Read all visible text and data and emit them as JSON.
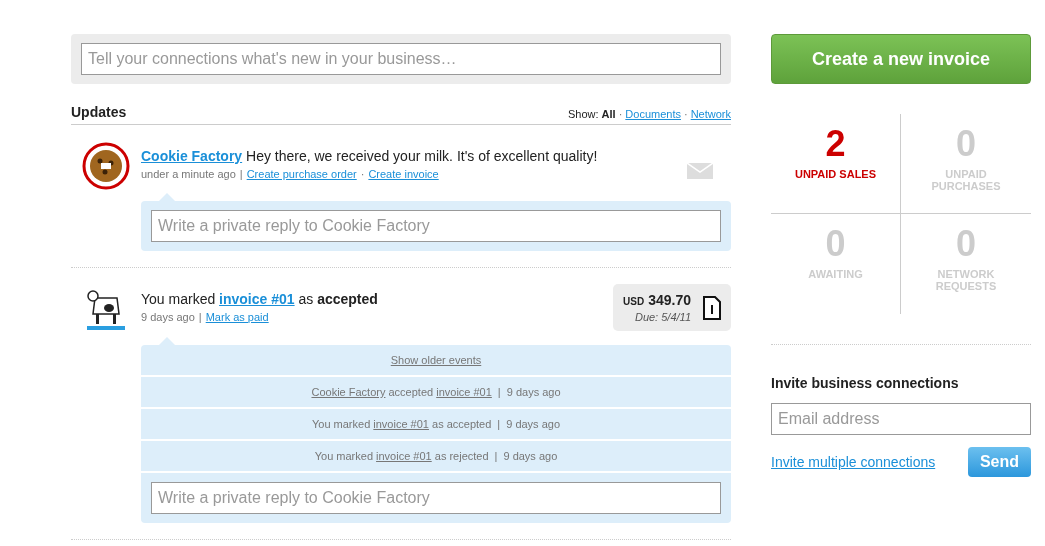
{
  "status_box": {
    "placeholder": "Tell your connections what's new in your business…"
  },
  "updates": {
    "title": "Updates",
    "filter_label": "Show:",
    "filters": [
      {
        "label": "All",
        "selected": true
      },
      {
        "separator": "·",
        "label": "Documents",
        "selected": false
      },
      {
        "separator": "·",
        "label": "Network",
        "selected": false
      }
    ],
    "items": [
      {
        "kind": "message",
        "avatar": {
          "kind": "picture"
        },
        "parts": [
          {
            "text": "Cookie Factory",
            "kind": "link"
          },
          {
            "text": " Hey there, we received your milk. It's of excellent quality!",
            "kind": "plain"
          }
        ],
        "time": "under a minute ago",
        "time_separator": "|",
        "actions": [
          {
            "label": "Create purchase order"
          },
          {
            "separator": "·",
            "label": "Create invoice"
          }
        ],
        "reply_placeholder": "Write a private reply to Cookie Factory"
      },
      {
        "kind": "invoice",
        "avatar": {
          "kind": "picture"
        },
        "parts": [
          {
            "text": "You marked ",
            "kind": "plain"
          },
          {
            "text": "invoice #01",
            "kind": "link"
          },
          {
            "text": " as ",
            "kind": "plain"
          },
          {
            "text": "accepted",
            "kind": "bold"
          }
        ],
        "time": "9 days ago",
        "time_separator": "|",
        "actions": [
          {
            "label": "Mark as paid"
          }
        ],
        "invoice": {
          "currency": "USD",
          "amount": "349.70",
          "due": "Due: 5/4/11"
        },
        "older_events_link": "Show older events",
        "events": [
          {
            "parts": [
              {
                "text": "Cookie Factory",
                "kind": "link"
              },
              {
                "text": " accepted ",
                "kind": "plain"
              },
              {
                "text": "invoice #01",
                "kind": "link"
              }
            ],
            "separator": "|",
            "time": "9 days ago"
          },
          {
            "parts": [
              {
                "text": "You marked ",
                "kind": "plain"
              },
              {
                "text": "invoice #01",
                "kind": "link"
              },
              {
                "text": " as accepted",
                "kind": "plain"
              }
            ],
            "separator": "|",
            "time": "9 days ago"
          },
          {
            "parts": [
              {
                "text": "You marked ",
                "kind": "plain"
              },
              {
                "text": "invoice #01",
                "kind": "link"
              },
              {
                "text": " as rejected",
                "kind": "plain"
              }
            ],
            "separator": "|",
            "time": "9 days ago"
          }
        ],
        "reply_placeholder": "Write a private reply to Cookie Factory"
      }
    ]
  },
  "create_button": "Create a new invoice",
  "stats": [
    {
      "value": "2",
      "label": "UNPAID SALES",
      "highlighted": true
    },
    {
      "value": "0",
      "label": "UNPAID PURCHASES",
      "highlighted": false
    },
    {
      "value": "0",
      "label": "AWAITING",
      "highlighted": false
    },
    {
      "value": "0",
      "label": "NETWORK REQUESTS",
      "highlighted": false
    }
  ],
  "invite": {
    "title": "Invite business connections",
    "placeholder": "Email address",
    "link": "Invite multiple connections",
    "button": "Send"
  }
}
